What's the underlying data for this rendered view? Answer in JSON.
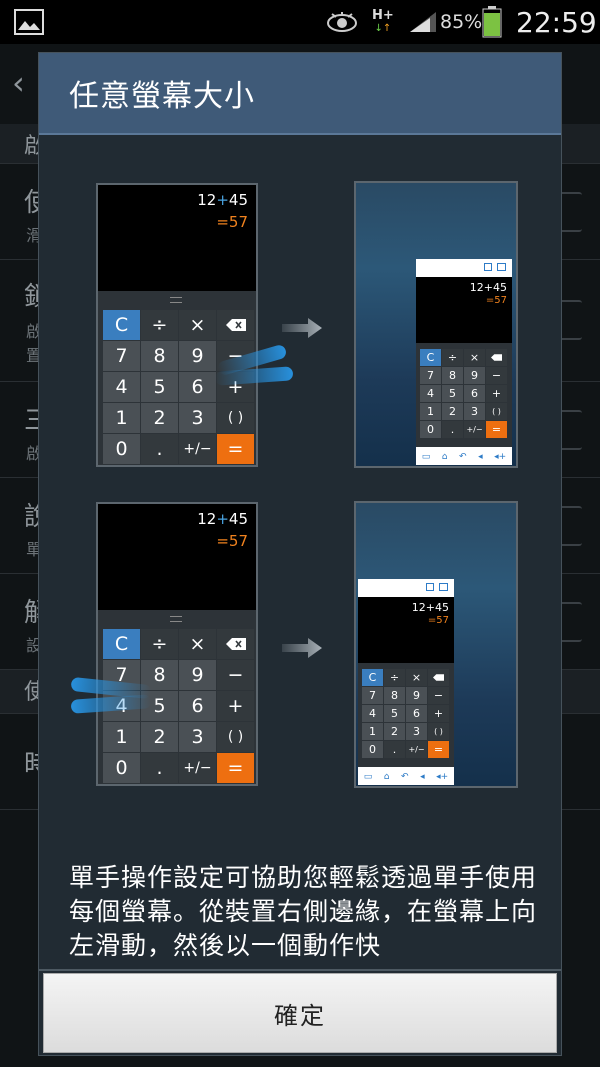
{
  "status_bar": {
    "network": "H+",
    "battery_percent": "85%",
    "time": "22:59",
    "battery_level": 0.85
  },
  "background_screen": {
    "letters": [
      "啟",
      "使",
      "鎖",
      "三",
      "說",
      "解",
      "使",
      "時"
    ],
    "subs": [
      "滑",
      "啟",
      "置",
      "啟",
      "單",
      "設"
    ]
  },
  "dialog": {
    "title": "任意螢幕大小",
    "description": "單手操作設定可協助您輕鬆透過單手使用每個螢幕。從裝置右側邊緣，在螢幕上向左滑動，然後以一個動作快",
    "ok_label": "確定"
  },
  "calculator": {
    "expression_left": "12",
    "expression_op": "+",
    "expression_right": "45",
    "result": "=57",
    "keys": [
      "C",
      "÷",
      "×",
      "⌫",
      "7",
      "8",
      "9",
      "−",
      "4",
      "5",
      "6",
      "+",
      "1",
      "2",
      "3",
      "( )",
      "0",
      ".",
      "+/−",
      "="
    ]
  },
  "mini_calculator": {
    "expression": "12+45",
    "result": "=57",
    "keys": [
      "C",
      "÷",
      "×",
      "⌫",
      "7",
      "8",
      "9",
      "−",
      "4",
      "5",
      "6",
      "+",
      "1",
      "2",
      "3",
      "( )",
      "0",
      ".",
      "+/−",
      "="
    ],
    "nav_icons": [
      "keyboard-icon",
      "home-icon",
      "back-icon",
      "volume-down-icon",
      "volume-up-icon"
    ]
  },
  "colors": {
    "dialog_header": "#3f5a78",
    "accent_blue": "#3a7ebf",
    "accent_orange": "#ee6f10",
    "battery_green": "#7cc242"
  }
}
